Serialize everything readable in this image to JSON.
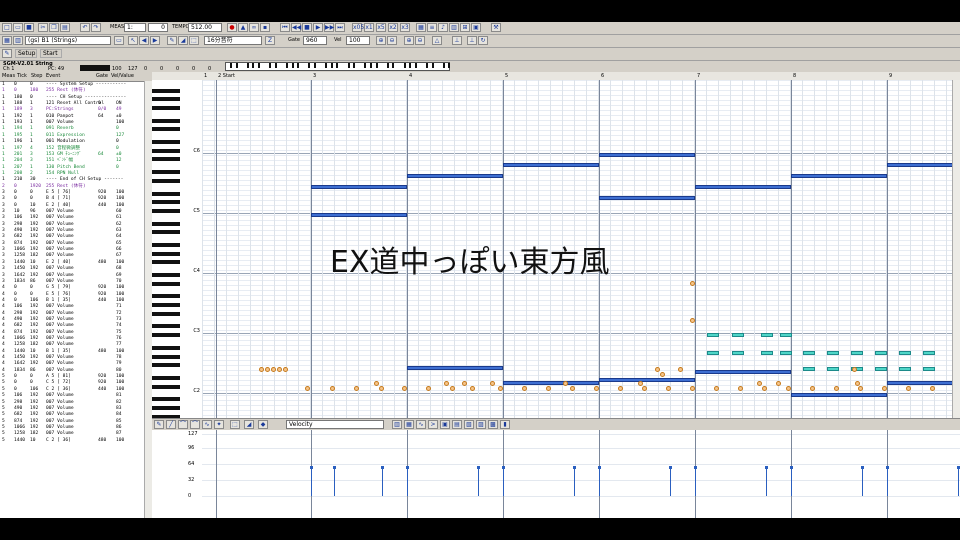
{
  "titlebar": {
    "title": "SGM-V2.01 String"
  },
  "toolbar1": {
    "meas_label": "MEAS",
    "meas_value": "1:",
    "tick_value": "0",
    "tempo_label": "TEMPO",
    "tempo_value": "512.00",
    "zoom_buttons": [
      "x05",
      "x1",
      "x5",
      "x2",
      "x3"
    ]
  },
  "toolbar2": {
    "instrument": "(gs) B1 (Strings)",
    "note_length": "16分音符",
    "gate_label": "Gate",
    "gate_value": "960",
    "vel_label": "Vel",
    "vel_value": "100"
  },
  "toolbar3": {
    "setup_tab": "Setup",
    "start_tab": "Start"
  },
  "track_info": {
    "name": "SGM-V2.01 String",
    "ch": "1",
    "pc": "49",
    "vals": [
      "100",
      "127",
      "0",
      "0",
      "0",
      "0",
      "0"
    ]
  },
  "event_list": {
    "headers": {
      "meas": "Meas",
      "tick": "Tick",
      "step": "Step",
      "event": "Event",
      "gate": "Gate",
      "vel": "Vel/Value"
    },
    "rows": [
      {
        "m": "1",
        "t": "0",
        "s": "0",
        "e": "---- System Setup -----------",
        "g": "",
        "v": "",
        "c": "#000"
      },
      {
        "m": "1",
        "t": "0",
        "s": "180",
        "e": "255 Rest (休符)",
        "g": "",
        "v": "",
        "c": "#7a2aa0"
      },
      {
        "m": "1",
        "t": "180",
        "s": "0",
        "e": "---- CH Setup ---------------",
        "g": "",
        "v": "",
        "c": "#000"
      },
      {
        "m": "1",
        "t": "188",
        "s": "1",
        "e": "121 Reset All Control",
        "g": "0",
        "v": "ON",
        "c": "#000"
      },
      {
        "m": "1",
        "t": "189",
        "s": "3",
        "e": "PC:Strings",
        "g": "0/0",
        "v": "49",
        "c": "#7a2aa0"
      },
      {
        "m": "1",
        "t": "192",
        "s": "1",
        "e": "010 Panpot",
        "g": "64",
        "v": "±0",
        "c": "#000"
      },
      {
        "m": "1",
        "t": "193",
        "s": "1",
        "e": "007 Volume",
        "g": "",
        "v": "100",
        "c": "#000"
      },
      {
        "m": "1",
        "t": "194",
        "s": "1",
        "e": "091 Reverb",
        "g": "",
        "v": "0",
        "c": "#1a8a3a"
      },
      {
        "m": "1",
        "t": "195",
        "s": "1",
        "e": "011 Expression",
        "g": "",
        "v": "127",
        "c": "#1a8a3a"
      },
      {
        "m": "1",
        "t": "196",
        "s": "1",
        "e": "001 Modulation",
        "g": "",
        "v": "0",
        "c": "#000"
      },
      {
        "m": "1",
        "t": "197",
        "s": "4",
        "e": "152 音程微調整",
        "g": "",
        "v": "0",
        "c": "#1a8a3a"
      },
      {
        "m": "1",
        "t": "201",
        "s": "3",
        "e": "153 GM ﾁｭｰﾆﾝｸﾞ",
        "g": "64",
        "v": "±0",
        "c": "#1a8a3a"
      },
      {
        "m": "1",
        "t": "204",
        "s": "3",
        "e": "151 ﾍﾞﾝﾄﾞ幅",
        "g": "",
        "v": "12",
        "c": "#1a8a3a"
      },
      {
        "m": "1",
        "t": "207",
        "s": "1",
        "e": "130 Pitch Bend",
        "g": "",
        "v": "0",
        "c": "#1a8a3a"
      },
      {
        "m": "1",
        "t": "208",
        "s": "2",
        "e": "154 RPN Null",
        "g": "",
        "v": "",
        "c": "#1a8a3a"
      },
      {
        "m": "1",
        "t": "210",
        "s": "30",
        "e": "---- End of CH Setup -------",
        "g": "",
        "v": "",
        "c": "#000"
      },
      {
        "m": "2",
        "t": "0",
        "s": "1920",
        "e": "255 Rest (休符)",
        "g": "",
        "v": "",
        "c": "#7a2aa0"
      },
      {
        "m": "3",
        "t": "0",
        "s": "0",
        "e": "E 5 [ 76]",
        "g": "920",
        "v": "100",
        "c": "#000"
      },
      {
        "m": "3",
        "t": "0",
        "s": "0",
        "e": "B 4 [ 71]",
        "g": "920",
        "v": "100",
        "c": "#000"
      },
      {
        "m": "3",
        "t": "0",
        "s": "10",
        "e": "E 2 [ 40]",
        "g": "440",
        "v": "100",
        "c": "#000"
      },
      {
        "m": "3",
        "t": "10",
        "s": "96",
        "e": "007 Volume",
        "g": "",
        "v": "60",
        "c": "#000"
      },
      {
        "m": "3",
        "t": "106",
        "s": "192",
        "e": "007 Volume",
        "g": "",
        "v": "61",
        "c": "#000"
      },
      {
        "m": "3",
        "t": "298",
        "s": "192",
        "e": "007 Volume",
        "g": "",
        "v": "62",
        "c": "#000"
      },
      {
        "m": "3",
        "t": "490",
        "s": "192",
        "e": "007 Volume",
        "g": "",
        "v": "63",
        "c": "#000"
      },
      {
        "m": "3",
        "t": "682",
        "s": "192",
        "e": "007 Volume",
        "g": "",
        "v": "64",
        "c": "#000"
      },
      {
        "m": "3",
        "t": "874",
        "s": "192",
        "e": "007 Volume",
        "g": "",
        "v": "65",
        "c": "#000"
      },
      {
        "m": "3",
        "t": "1066",
        "s": "192",
        "e": "007 Volume",
        "g": "",
        "v": "66",
        "c": "#000"
      },
      {
        "m": "3",
        "t": "1258",
        "s": "182",
        "e": "007 Volume",
        "g": "",
        "v": "67",
        "c": "#000"
      },
      {
        "m": "3",
        "t": "1440",
        "s": "10",
        "e": "E 2 [ 40]",
        "g": "480",
        "v": "100",
        "c": "#000"
      },
      {
        "m": "3",
        "t": "1450",
        "s": "192",
        "e": "007 Volume",
        "g": "",
        "v": "68",
        "c": "#000"
      },
      {
        "m": "3",
        "t": "1642",
        "s": "192",
        "e": "007 Volume",
        "g": "",
        "v": "69",
        "c": "#000"
      },
      {
        "m": "3",
        "t": "1834",
        "s": "86",
        "e": "007 Volume",
        "g": "",
        "v": "70",
        "c": "#000"
      },
      {
        "m": "4",
        "t": "0",
        "s": "0",
        "e": "G 5 [ 79]",
        "g": "920",
        "v": "100",
        "c": "#000"
      },
      {
        "m": "4",
        "t": "0",
        "s": "0",
        "e": "E 5 [ 76]",
        "g": "920",
        "v": "100",
        "c": "#000"
      },
      {
        "m": "4",
        "t": "0",
        "s": "106",
        "e": "B 1 [ 35]",
        "g": "440",
        "v": "100",
        "c": "#000"
      },
      {
        "m": "4",
        "t": "106",
        "s": "192",
        "e": "007 Volume",
        "g": "",
        "v": "71",
        "c": "#000"
      },
      {
        "m": "4",
        "t": "298",
        "s": "192",
        "e": "007 Volume",
        "g": "",
        "v": "72",
        "c": "#000"
      },
      {
        "m": "4",
        "t": "490",
        "s": "192",
        "e": "007 Volume",
        "g": "",
        "v": "73",
        "c": "#000"
      },
      {
        "m": "4",
        "t": "682",
        "s": "192",
        "e": "007 Volume",
        "g": "",
        "v": "74",
        "c": "#000"
      },
      {
        "m": "4",
        "t": "874",
        "s": "192",
        "e": "007 Volume",
        "g": "",
        "v": "75",
        "c": "#000"
      },
      {
        "m": "4",
        "t": "1066",
        "s": "192",
        "e": "007 Volume",
        "g": "",
        "v": "76",
        "c": "#000"
      },
      {
        "m": "4",
        "t": "1258",
        "s": "182",
        "e": "007 Volume",
        "g": "",
        "v": "77",
        "c": "#000"
      },
      {
        "m": "4",
        "t": "1440",
        "s": "10",
        "e": "B 1 [ 35]",
        "g": "480",
        "v": "100",
        "c": "#000"
      },
      {
        "m": "4",
        "t": "1450",
        "s": "192",
        "e": "007 Volume",
        "g": "",
        "v": "78",
        "c": "#000"
      },
      {
        "m": "4",
        "t": "1642",
        "s": "192",
        "e": "007 Volume",
        "g": "",
        "v": "79",
        "c": "#000"
      },
      {
        "m": "4",
        "t": "1834",
        "s": "86",
        "e": "007 Volume",
        "g": "",
        "v": "80",
        "c": "#000"
      },
      {
        "m": "5",
        "t": "0",
        "s": "0",
        "e": "A 5 [ 81]",
        "g": "920",
        "v": "100",
        "c": "#000"
      },
      {
        "m": "5",
        "t": "0",
        "s": "0",
        "e": "C 5 [ 72]",
        "g": "920",
        "v": "100",
        "c": "#000"
      },
      {
        "m": "5",
        "t": "0",
        "s": "106",
        "e": "C 2 [ 36]",
        "g": "440",
        "v": "100",
        "c": "#000"
      },
      {
        "m": "5",
        "t": "106",
        "s": "192",
        "e": "007 Volume",
        "g": "",
        "v": "81",
        "c": "#000"
      },
      {
        "m": "5",
        "t": "298",
        "s": "192",
        "e": "007 Volume",
        "g": "",
        "v": "82",
        "c": "#000"
      },
      {
        "m": "5",
        "t": "490",
        "s": "192",
        "e": "007 Volume",
        "g": "",
        "v": "83",
        "c": "#000"
      },
      {
        "m": "5",
        "t": "682",
        "s": "192",
        "e": "007 Volume",
        "g": "",
        "v": "84",
        "c": "#000"
      },
      {
        "m": "5",
        "t": "874",
        "s": "192",
        "e": "007 Volume",
        "g": "",
        "v": "85",
        "c": "#000"
      },
      {
        "m": "5",
        "t": "1066",
        "s": "192",
        "e": "007 Volume",
        "g": "",
        "v": "86",
        "c": "#000"
      },
      {
        "m": "5",
        "t": "1258",
        "s": "182",
        "e": "007 Volume",
        "g": "",
        "v": "87",
        "c": "#000"
      },
      {
        "m": "5",
        "t": "1440",
        "s": "10",
        "e": "C 2 [ 36]",
        "g": "480",
        "v": "100",
        "c": "#000"
      }
    ]
  },
  "ruler": {
    "measures": [
      "1",
      "2 Start",
      "3",
      "4",
      "5",
      "6",
      "7",
      "8",
      "9"
    ]
  },
  "keyboard": {
    "c_labels": [
      "C6",
      "C5",
      "C4",
      "C3",
      "C2"
    ]
  },
  "overlay_text": "EX道中っぽい東方風",
  "velocity_panel": {
    "mode": "Velocity",
    "ticks": [
      "127",
      "96",
      "64",
      "32",
      "0"
    ]
  },
  "colors": {
    "note": "#3e6fd2",
    "selected_note": "#4fd6c8",
    "control_dot": "#f6c58a"
  }
}
